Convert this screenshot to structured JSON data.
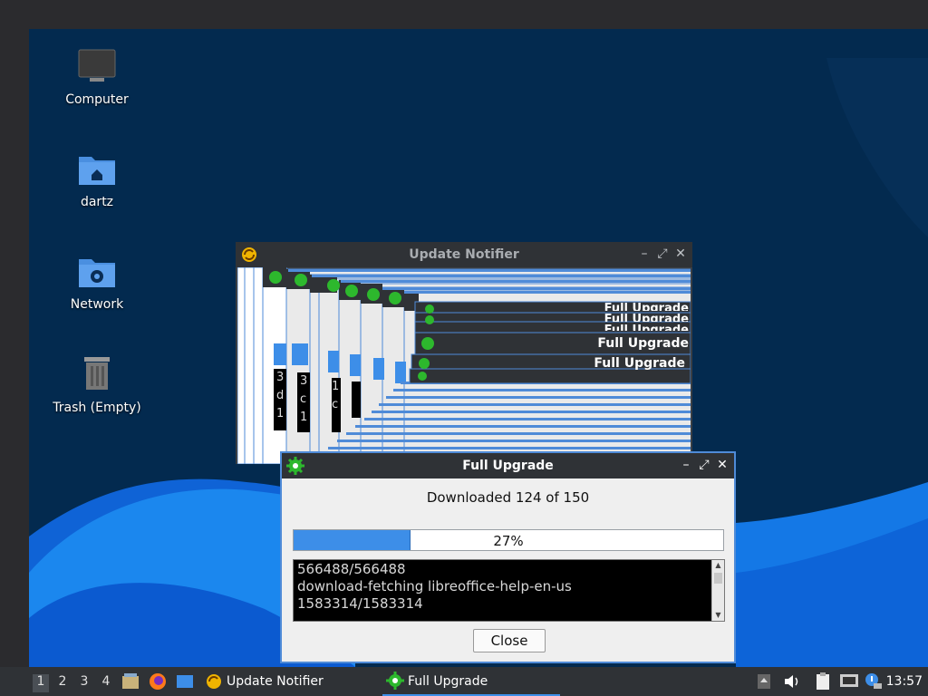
{
  "desktop": {
    "icons": [
      {
        "label": "Computer",
        "icon": "computer-icon"
      },
      {
        "label": "dartz",
        "icon": "home-folder-icon"
      },
      {
        "label": "Network",
        "icon": "network-folder-icon"
      },
      {
        "label": "Trash (Empty)",
        "icon": "trash-icon"
      }
    ]
  },
  "update_notifier": {
    "title": "Update Notifier",
    "stack_titles": [
      "Full Upgrade",
      "Full Upgrade",
      "Full Upgrade",
      "Full Upgrade",
      "Full Upgrade"
    ],
    "stack_fragments": [
      "3",
      "d",
      "1",
      "3",
      "c",
      "1",
      "1",
      "c"
    ]
  },
  "full_upgrade": {
    "title": "Full Upgrade",
    "status": "Downloaded 124 of 150",
    "progress_text": "27%",
    "progress_fraction": 0.27,
    "log_lines": [
      "566488/566488",
      "download-fetching libreoffice-help-en-us",
      "1583314/1583314"
    ],
    "close_label": "Close"
  },
  "taskbar": {
    "workspaces": [
      "1",
      "2",
      "3",
      "4"
    ],
    "active_workspace": 0,
    "tasks": [
      {
        "label": "Update Notifier",
        "icon": "update-notifier-icon"
      },
      {
        "label": "Full Upgrade",
        "icon": "gear-icon"
      }
    ],
    "clock": "13:57"
  },
  "colors": {
    "desktop_bg": "#032a4f",
    "wave_light": "#1b87ee",
    "accent": "#3d8ee8",
    "titlebar": "#2f3236"
  }
}
